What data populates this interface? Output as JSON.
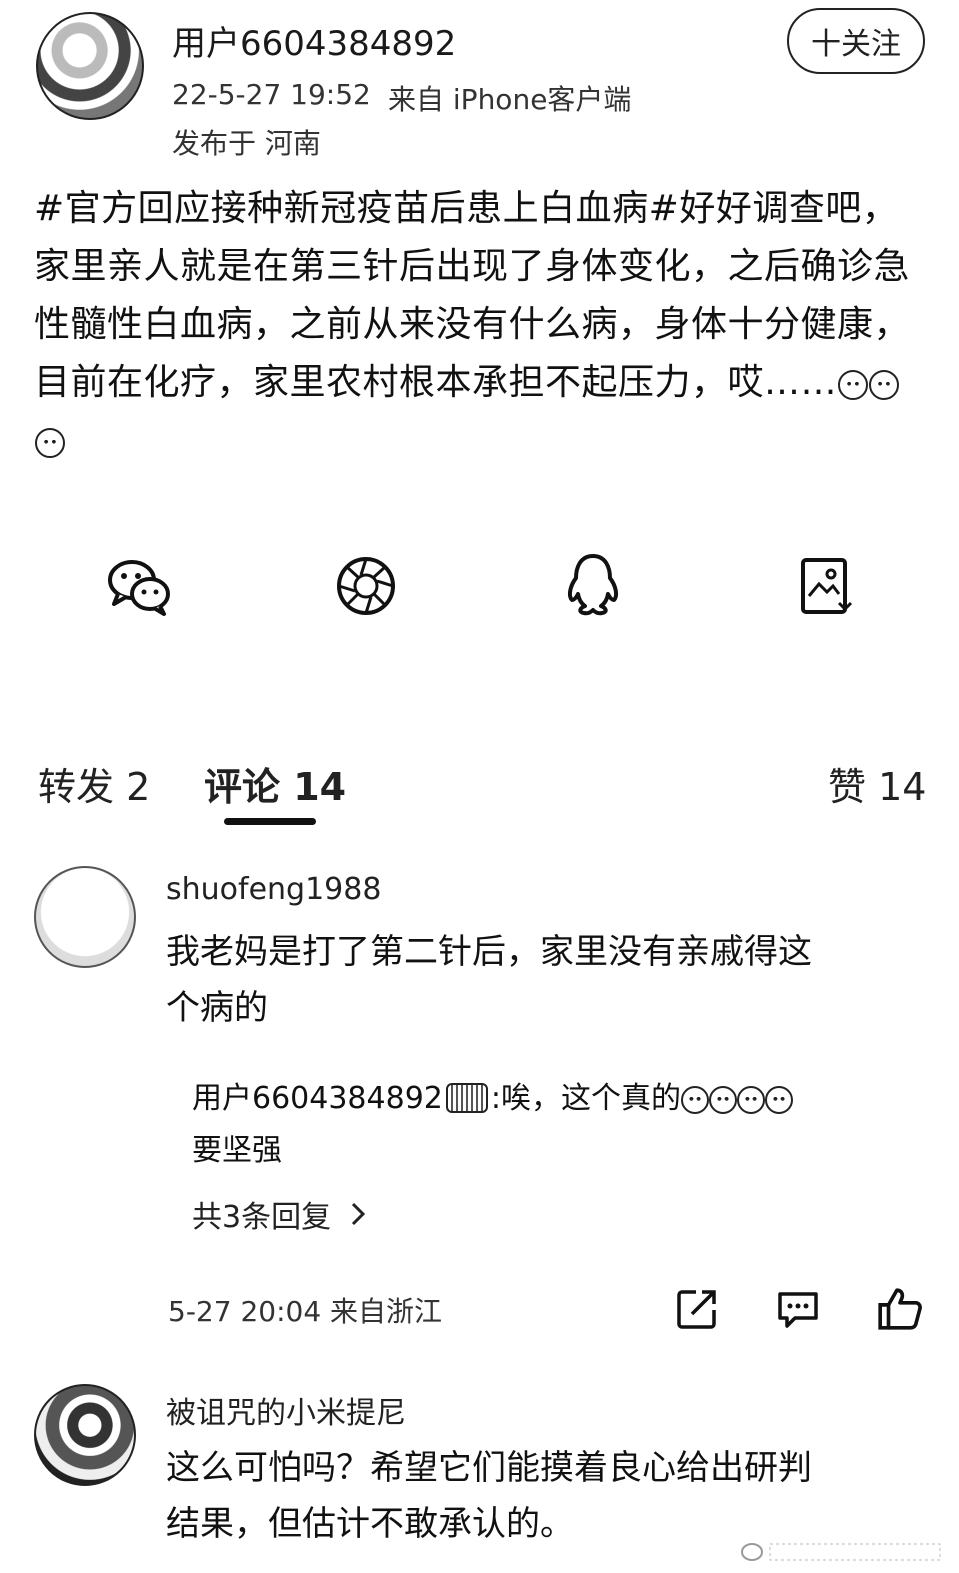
{
  "post": {
    "author": "用户6604384892",
    "time": "22-5-27 19:52",
    "source": "来自 iPhone客户端",
    "location": "发布于 河南",
    "follow_label": "十关注",
    "text": "#官方回应接种新冠疫苗后患上白血病#好好调查吧，家里亲人就是在第三针后出现了身体变化，之后确诊急性髓性白血病，之前从来没有什么病，身体十分健康，目前在化疗，家里农村根本承担不起压力，哎……",
    "share_icons": [
      "wechat-icon",
      "moments-icon",
      "qq-icon",
      "save-image-icon"
    ]
  },
  "tabs": {
    "repost": "转发 2",
    "comments": "评论 14",
    "likes": "赞 14"
  },
  "comments": [
    {
      "author": "shuofeng1988",
      "text_line1": "我老妈是打了第二针后，家里没有亲戚得这",
      "text_line2": "个病的",
      "reply": {
        "author": "用户6604384892",
        "text": ":唉，这个真的",
        "text_line2": "要坚强"
      },
      "more_replies": "共3条回复",
      "meta": "5-27 20:04 来自浙江"
    },
    {
      "author": "被诅咒的小米提尼",
      "text_line1": "这么可怕吗？希望它们能摸着良心给出研判",
      "text_line2": "结果，但估计不敢承认的。"
    }
  ],
  "colors": {
    "text": "#111111",
    "meta": "#333333",
    "background": "#ffffff"
  }
}
